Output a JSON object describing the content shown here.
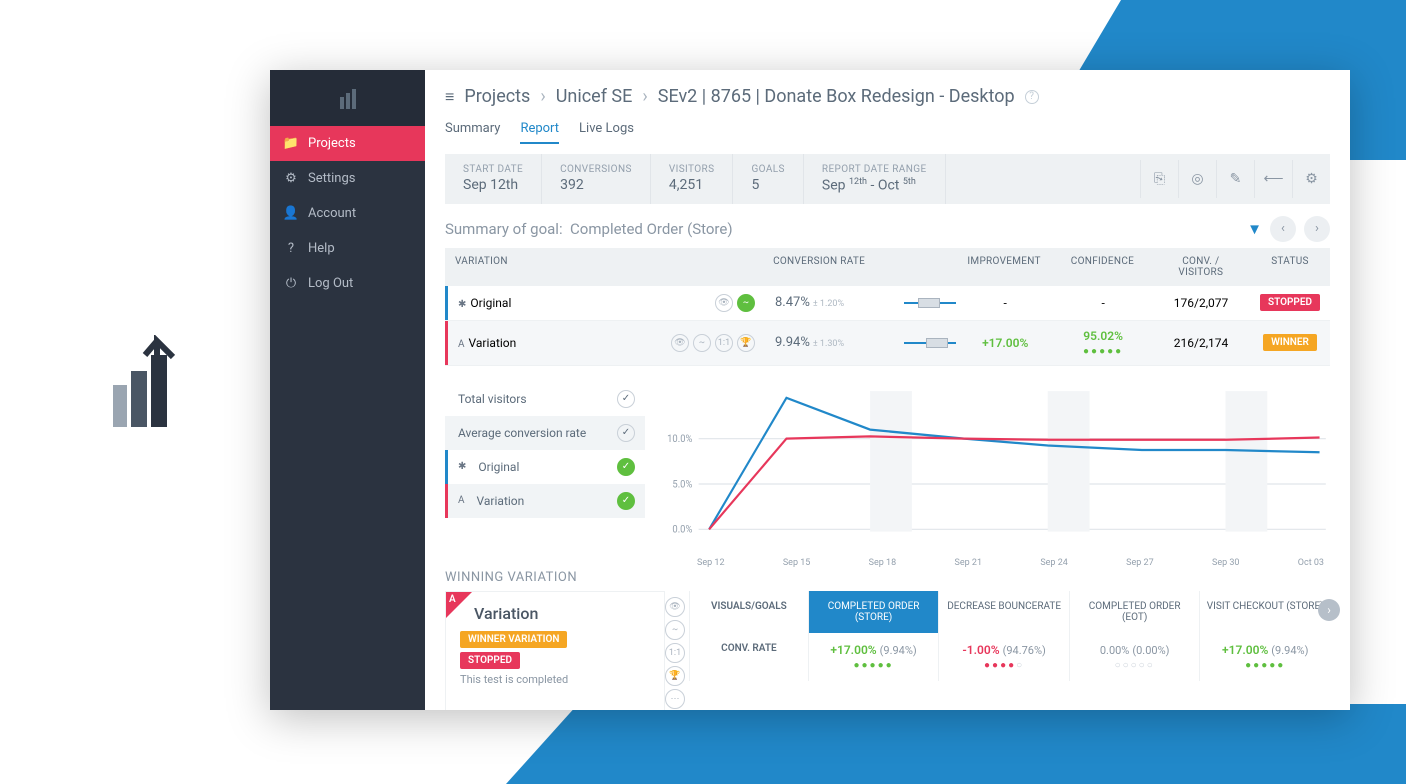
{
  "sidebar": {
    "items": [
      {
        "label": "Projects",
        "icon": "folder"
      },
      {
        "label": "Settings",
        "icon": "gears"
      },
      {
        "label": "Account",
        "icon": "user"
      },
      {
        "label": "Help",
        "icon": "help"
      },
      {
        "label": "Log Out",
        "icon": "power"
      }
    ]
  },
  "breadcrumb": {
    "root": "Projects",
    "level1": "Unicef SE",
    "level2": "SEv2 | 8765 | Donate Box Redesign - Desktop"
  },
  "tabs": [
    {
      "label": "Summary"
    },
    {
      "label": "Report"
    },
    {
      "label": "Live Logs"
    }
  ],
  "stats": {
    "start_date": {
      "label": "START DATE",
      "value": "Sep 12th"
    },
    "conversions": {
      "label": "CONVERSIONS",
      "value": "392"
    },
    "visitors": {
      "label": "VISITORS",
      "value": "4,251"
    },
    "goals": {
      "label": "GOALS",
      "value": "5"
    },
    "range": {
      "label": "REPORT DATE RANGE",
      "value_html": "Sep 12th - Oct 5th"
    }
  },
  "goal_summary": {
    "prefix": "Summary of goal:",
    "name": "Completed Order (Store)"
  },
  "table": {
    "headers": {
      "variation": "VARIATION",
      "rate": "CONVERSION RATE",
      "improvement": "IMPROVEMENT",
      "confidence": "CONFIDENCE",
      "cv": "CONV. / VISITORS",
      "status": "STATUS"
    },
    "rows": [
      {
        "name": "Original",
        "marker": "✱",
        "stripe": "#2188c9",
        "rate": "8.47%",
        "rate_pm": "± 1.20%",
        "improvement": "-",
        "confidence": "-",
        "cv": "176/2,077",
        "status": "STOPPED",
        "status_class": "stopped"
      },
      {
        "name": "Variation",
        "marker": "A",
        "stripe": "#e7375b",
        "rate": "9.94%",
        "rate_pm": "± 1.30%",
        "improvement": "+17.00%",
        "confidence": "95.02%",
        "cv": "216/2,174",
        "status": "WINNER",
        "status_class": "winner"
      }
    ]
  },
  "legend": [
    {
      "label": "Total visitors",
      "on": false
    },
    {
      "label": "Average conversion rate",
      "on": false
    },
    {
      "label": "Original",
      "on": true,
      "marker": "✱",
      "stripe": "blue"
    },
    {
      "label": "Variation",
      "on": true,
      "marker": "A",
      "stripe": "pink"
    }
  ],
  "chart_data": {
    "type": "line",
    "xlabel": "",
    "ylabel": "",
    "ylim": [
      0,
      15
    ],
    "y_ticks": [
      "0.0%",
      "5.0%",
      "10.0%"
    ],
    "categories": [
      "Sep 12",
      "Sep 15",
      "Sep 18",
      "Sep 21",
      "Sep 24",
      "Sep 27",
      "Sep 30",
      "Oct 03"
    ],
    "series": [
      {
        "name": "Original",
        "color": "#2188c9",
        "values": [
          0.0,
          14.5,
          11.0,
          9.8,
          9.0,
          8.8,
          8.7,
          8.5
        ]
      },
      {
        "name": "Variation",
        "color": "#e7375b",
        "values": [
          0.0,
          10.0,
          10.2,
          10.0,
          9.9,
          9.9,
          9.9,
          10.0
        ]
      }
    ]
  },
  "winning": {
    "title": "WINNING VARIATION",
    "card": {
      "letter": "A",
      "name": "Variation",
      "badge1": "WINNER VARIATION",
      "badge2": "STOPPED",
      "note": "This test is completed"
    },
    "goals_header": {
      "label": "VISUALS/GOALS",
      "cols": [
        "COMPLETED ORDER (STORE)",
        "DECREASE BOUNCERATE",
        "COMPLETED ORDER (EOT)",
        "VISIT CHECKOUT (STORE)"
      ]
    },
    "conv_row": {
      "label": "CONV. RATE",
      "cells": [
        {
          "delta": "+17.00%",
          "pct": "(9.94%)",
          "cls": "pos",
          "dots": "green",
          "dotcount": 5
        },
        {
          "delta": "-1.00%",
          "pct": "(94.76%)",
          "cls": "neg",
          "dots": "red",
          "dotcount": 4
        },
        {
          "delta": "0.00%",
          "pct": "(0.00%)",
          "cls": "zero",
          "dots": "gray",
          "dotcount": 0
        },
        {
          "delta": "+17.00%",
          "pct": "(9.94%)",
          "cls": "pos",
          "dots": "green",
          "dotcount": 5
        }
      ]
    }
  }
}
